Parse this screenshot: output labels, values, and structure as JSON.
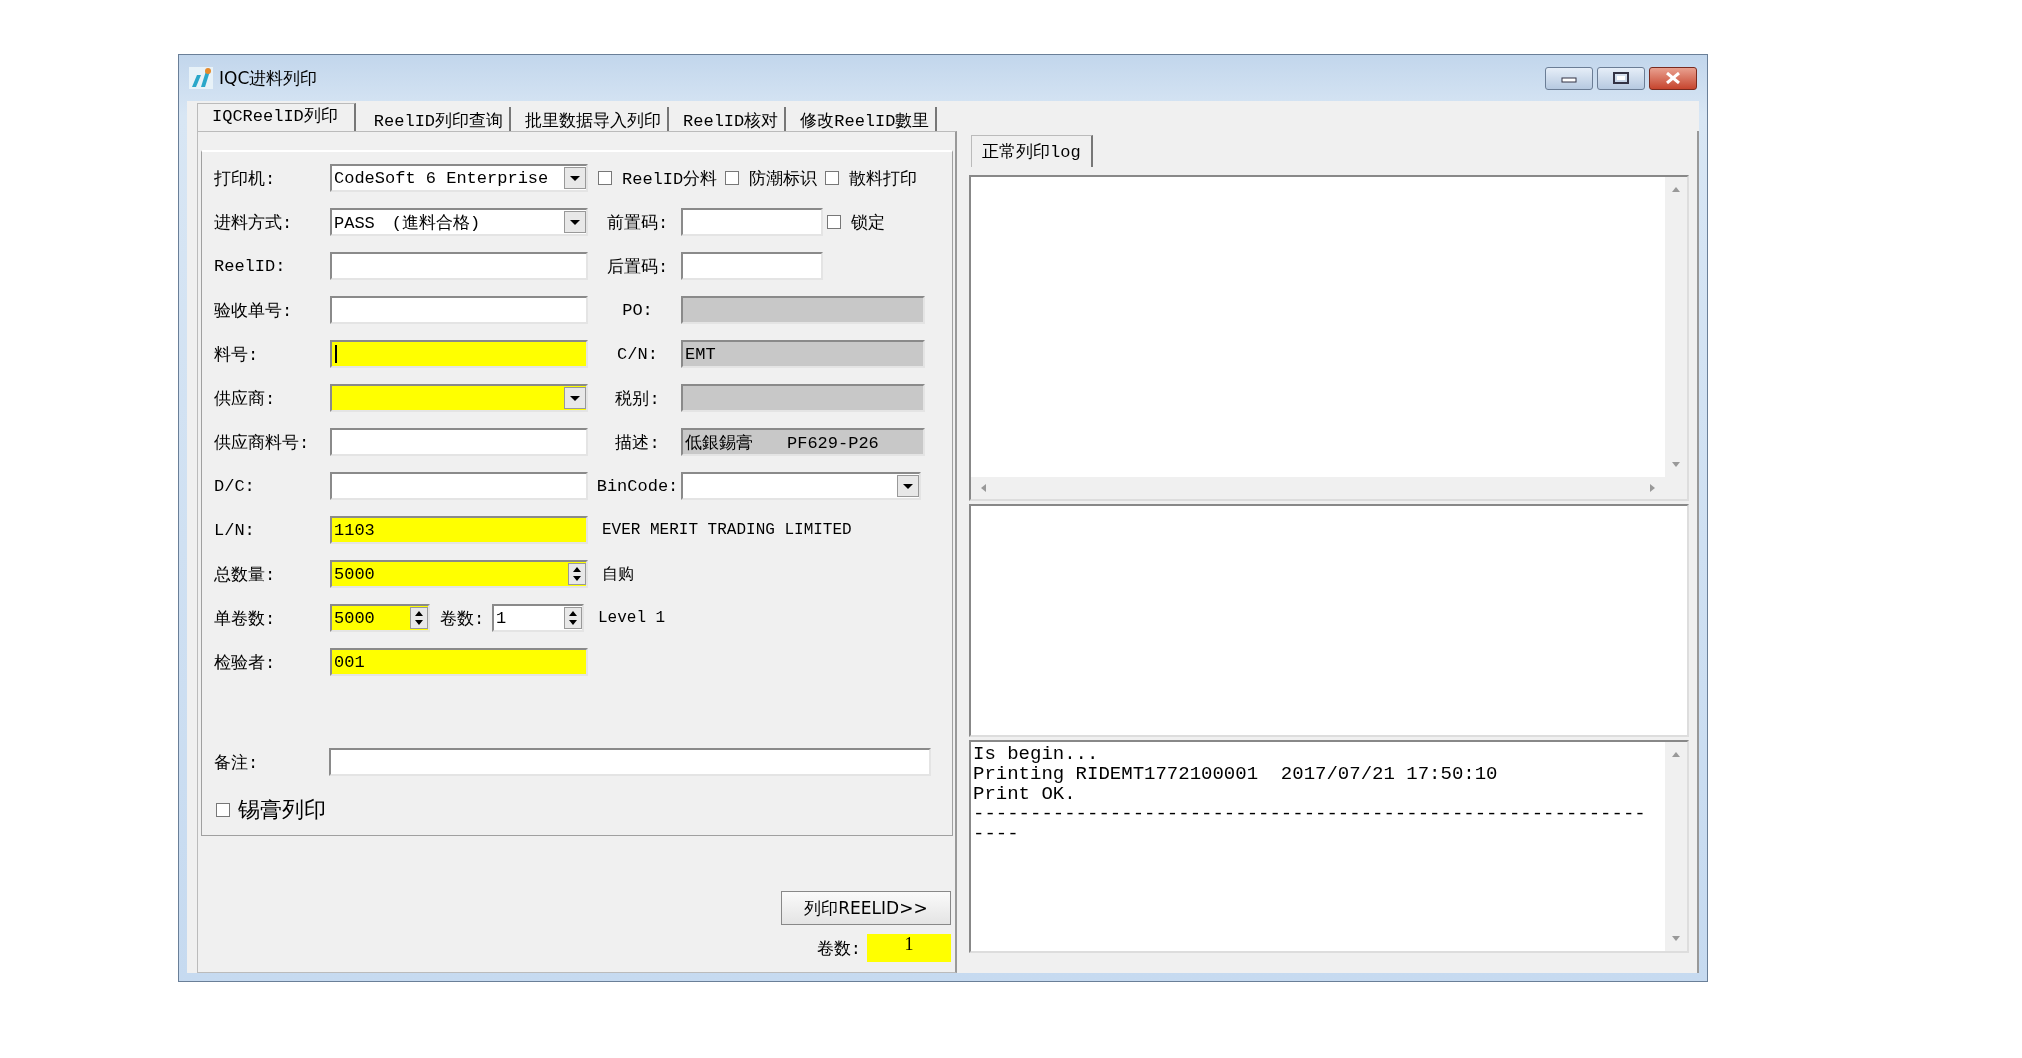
{
  "window": {
    "title": "IQC进料列印"
  },
  "tabs": [
    {
      "label": "IQCReelID列印",
      "selected": true
    },
    {
      "label": "ReelID列印查询",
      "selected": false
    },
    {
      "label": "批里数据导入列印",
      "selected": false
    },
    {
      "label": "ReelID核对",
      "selected": false
    },
    {
      "label": "修改ReelID數里",
      "selected": false
    }
  ],
  "form": {
    "rows": [
      {
        "left": {
          "label": "打印机:",
          "control": {
            "kind": "combo",
            "value": "CodeSoft 6 Enterprise",
            "highlighted": false
          }
        },
        "right": [
          {
            "kind": "checkbox",
            "label": "ReelID分料",
            "checked": false
          },
          {
            "kind": "checkbox",
            "label": "防潮标识",
            "checked": false
          },
          {
            "kind": "checkbox",
            "label": "散料打印",
            "checked": false
          }
        ]
      },
      {
        "left": {
          "label": "进料方式:",
          "control": {
            "kind": "combo",
            "value": "PASS　(進料合格)",
            "highlighted": false
          }
        },
        "right": [
          {
            "kind": "text_field",
            "label": "前置码:"
          },
          {
            "kind": "checkbox",
            "label": "锁定",
            "checked": false
          }
        ]
      },
      {
        "left": {
          "label": "ReelID:",
          "control": {
            "kind": "text",
            "highlighted": false
          }
        },
        "right": [
          {
            "kind": "text_field",
            "label": "后置码:"
          }
        ]
      },
      {
        "left": {
          "label": "验收单号:",
          "control": {
            "kind": "text",
            "highlighted": false
          }
        },
        "right": [
          {
            "kind": "readonly_field",
            "label": "PO:"
          }
        ]
      },
      {
        "left": {
          "label": "料号:",
          "control": {
            "kind": "text",
            "highlighted": true,
            "focused": true
          }
        },
        "right": [
          {
            "kind": "readonly_field",
            "label": "C/N:",
            "value": "EMT"
          }
        ]
      },
      {
        "left": {
          "label": "供应商:",
          "control": {
            "kind": "combo",
            "highlighted": true
          }
        },
        "right": [
          {
            "kind": "readonly_field",
            "label": "税别:"
          }
        ]
      },
      {
        "left": {
          "label": "供应商料号:",
          "control": {
            "kind": "text",
            "highlighted": false
          }
        },
        "right": [
          {
            "kind": "readonly_field",
            "label": "描述:",
            "value": "低銀錫膏　　PF629-P26"
          }
        ]
      },
      {
        "left": {
          "label": "D/C:",
          "control": {
            "kind": "text",
            "highlighted": false
          }
        },
        "right": [
          {
            "kind": "combo_field",
            "label": "BinCode:"
          }
        ]
      },
      {
        "left": {
          "label": "L/N:",
          "control": {
            "kind": "text",
            "highlighted": true,
            "value": "1103"
          }
        },
        "right": [
          {
            "kind": "text",
            "text": "EVER MERIT TRADING LIMITED"
          }
        ]
      },
      {
        "left": {
          "label": "总数量:",
          "control": {
            "kind": "spin",
            "highlighted": true,
            "value": "5000"
          }
        },
        "right": [
          {
            "kind": "text",
            "text": "自购"
          }
        ]
      },
      {
        "left": {
          "label": "单卷数:",
          "control": {
            "kind": "spin",
            "highlighted": true,
            "value": "5000"
          },
          "extra": {
            "label": "卷数:",
            "control": {
              "kind": "spin",
              "highlighted": false,
              "value": "1"
            }
          }
        },
        "right": [
          {
            "kind": "text",
            "text": "Level 1"
          }
        ]
      },
      {
        "left": {
          "label": "检验者:",
          "control": {
            "kind": "text",
            "highlighted": true,
            "value": "001"
          }
        },
        "right": []
      }
    ],
    "remark": {
      "label": "备注:"
    },
    "solder_print": {
      "label": "锡膏列印",
      "checked": false
    }
  },
  "print_button": "列印REELID>>",
  "reel_count": {
    "label": "卷数:",
    "value": "1"
  },
  "log_panel": {
    "tabs": [
      {
        "label": "正常列印log",
        "selected": true
      }
    ],
    "lines": [
      "Is begin...",
      "Printing RIDEMT1772100001  2017/07/21 17:50:10",
      "Print OK.",
      "-----------------------------------------------------------",
      "----"
    ]
  }
}
